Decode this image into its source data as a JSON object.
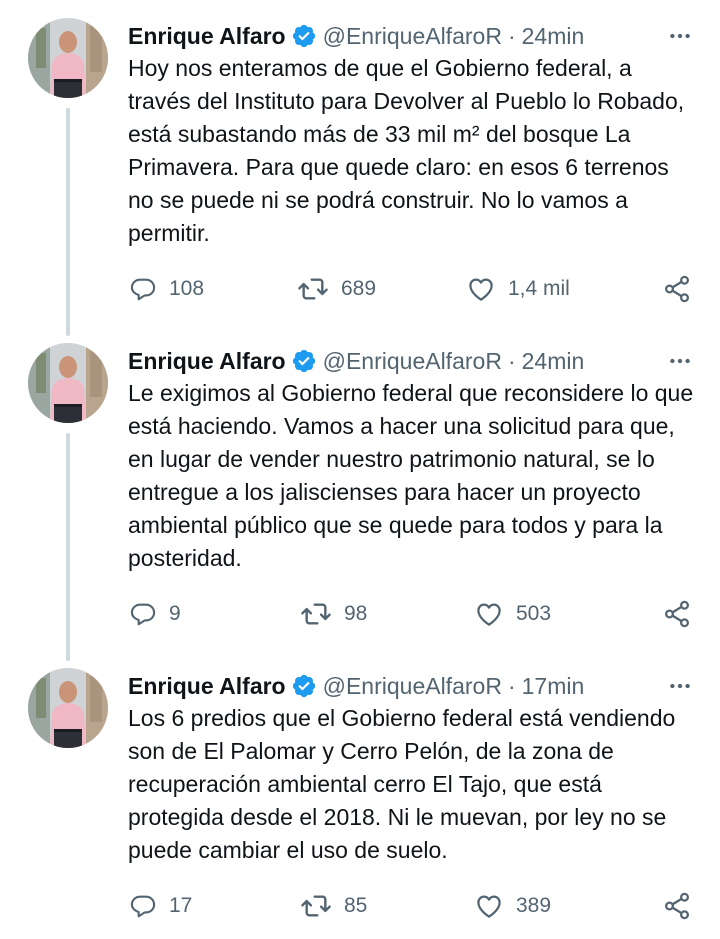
{
  "tweets": [
    {
      "author": "Enrique Alfaro",
      "handle": "@EnriqueAlfaroR",
      "separator": "·",
      "time": "24min",
      "text": "Hoy nos enteramos de que el Gobierno federal, a través del Instituto para Devolver al Pueblo lo Robado, está subastando más de 33 mil m² del bosque La Primavera. Para que quede claro: en esos 6 terrenos no se puede ni se podrá construir. No lo vamos a permitir.",
      "replies": "108",
      "retweets": "689",
      "likes": "1,4 mil"
    },
    {
      "author": "Enrique Alfaro",
      "handle": "@EnriqueAlfaroR",
      "separator": "·",
      "time": "24min",
      "text": "Le exigimos al Gobierno federal que reconsidere lo que está haciendo. Vamos a hacer una solicitud para que, en lugar de vender nuestro patrimonio natural, se lo entregue a los jaliscienses para hacer un proyecto ambiental público que se quede para todos y para la posteridad.",
      "replies": "9",
      "retweets": "98",
      "likes": "503"
    },
    {
      "author": "Enrique Alfaro",
      "handle": "@EnriqueAlfaroR",
      "separator": "·",
      "time": "17min",
      "text": "Los 6 predios que el Gobierno federal está vendiendo son de El Palomar y Cerro Pelón, de la zona de recuperación ambiental cerro El Tajo, que está protegida desde el 2018. Ni le muevan, por ley no se puede cambiar el uso de suelo.",
      "replies": "17",
      "retweets": "85",
      "likes": "389"
    }
  ],
  "icons": {
    "verified": "verified-badge-icon",
    "more": "more-options-icon",
    "reply": "reply-icon",
    "retweet": "retweet-icon",
    "like": "heart-icon",
    "share": "share-icon"
  },
  "colors": {
    "verified": "#1d9bf0",
    "secondary_text": "#536471",
    "thread_line": "#cfd9de"
  }
}
